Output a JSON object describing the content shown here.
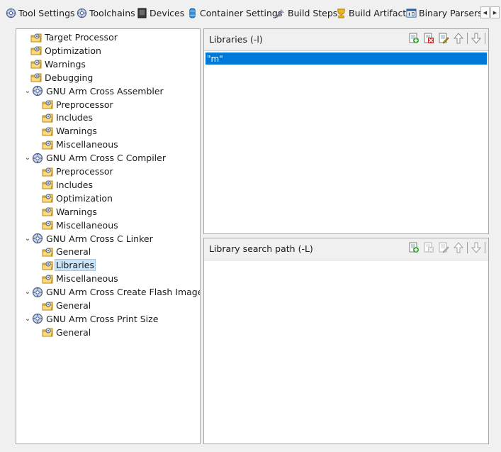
{
  "tabs": [
    {
      "label": "Tool Settings",
      "icon": "tool-settings-icon"
    },
    {
      "label": "Toolchains",
      "icon": "toolchains-icon"
    },
    {
      "label": "Devices",
      "icon": "devices-icon"
    },
    {
      "label": "Container Settings",
      "icon": "container-settings-icon"
    },
    {
      "label": "Build Steps",
      "icon": "build-steps-icon"
    },
    {
      "label": "Build Artifact",
      "icon": "build-artifact-icon"
    },
    {
      "label": "Binary Parsers",
      "icon": "binary-parsers-icon"
    }
  ],
  "tree": [
    {
      "label": "Target Processor",
      "level": 1,
      "type": "page"
    },
    {
      "label": "Optimization",
      "level": 1,
      "type": "page"
    },
    {
      "label": "Warnings",
      "level": 1,
      "type": "page"
    },
    {
      "label": "Debugging",
      "level": 1,
      "type": "page"
    },
    {
      "label": "GNU Arm Cross Assembler",
      "level": 0,
      "type": "tool",
      "expanded": true
    },
    {
      "label": "Preprocessor",
      "level": 2,
      "type": "page"
    },
    {
      "label": "Includes",
      "level": 2,
      "type": "page"
    },
    {
      "label": "Warnings",
      "level": 2,
      "type": "page"
    },
    {
      "label": "Miscellaneous",
      "level": 2,
      "type": "page"
    },
    {
      "label": "GNU Arm Cross C Compiler",
      "level": 0,
      "type": "tool",
      "expanded": true
    },
    {
      "label": "Preprocessor",
      "level": 2,
      "type": "page"
    },
    {
      "label": "Includes",
      "level": 2,
      "type": "page"
    },
    {
      "label": "Optimization",
      "level": 2,
      "type": "page"
    },
    {
      "label": "Warnings",
      "level": 2,
      "type": "page"
    },
    {
      "label": "Miscellaneous",
      "level": 2,
      "type": "page"
    },
    {
      "label": "GNU Arm Cross C Linker",
      "level": 0,
      "type": "tool",
      "expanded": true
    },
    {
      "label": "General",
      "level": 2,
      "type": "page"
    },
    {
      "label": "Libraries",
      "level": 2,
      "type": "page",
      "selected": true
    },
    {
      "label": "Miscellaneous",
      "level": 2,
      "type": "page"
    },
    {
      "label": "GNU Arm Cross Create Flash Image",
      "level": 0,
      "type": "tool",
      "expanded": true
    },
    {
      "label": "General",
      "level": 2,
      "type": "page"
    },
    {
      "label": "GNU Arm Cross Print Size",
      "level": 0,
      "type": "tool",
      "expanded": true
    },
    {
      "label": "General",
      "level": 2,
      "type": "page"
    }
  ],
  "libraries": {
    "title": "Libraries (-l)",
    "items": [
      "\"m\""
    ]
  },
  "library_search_path": {
    "title": "Library search path (-L)",
    "items": []
  },
  "colors": {
    "selection": "#0078d7",
    "tree_selection": "#cce4f7"
  }
}
